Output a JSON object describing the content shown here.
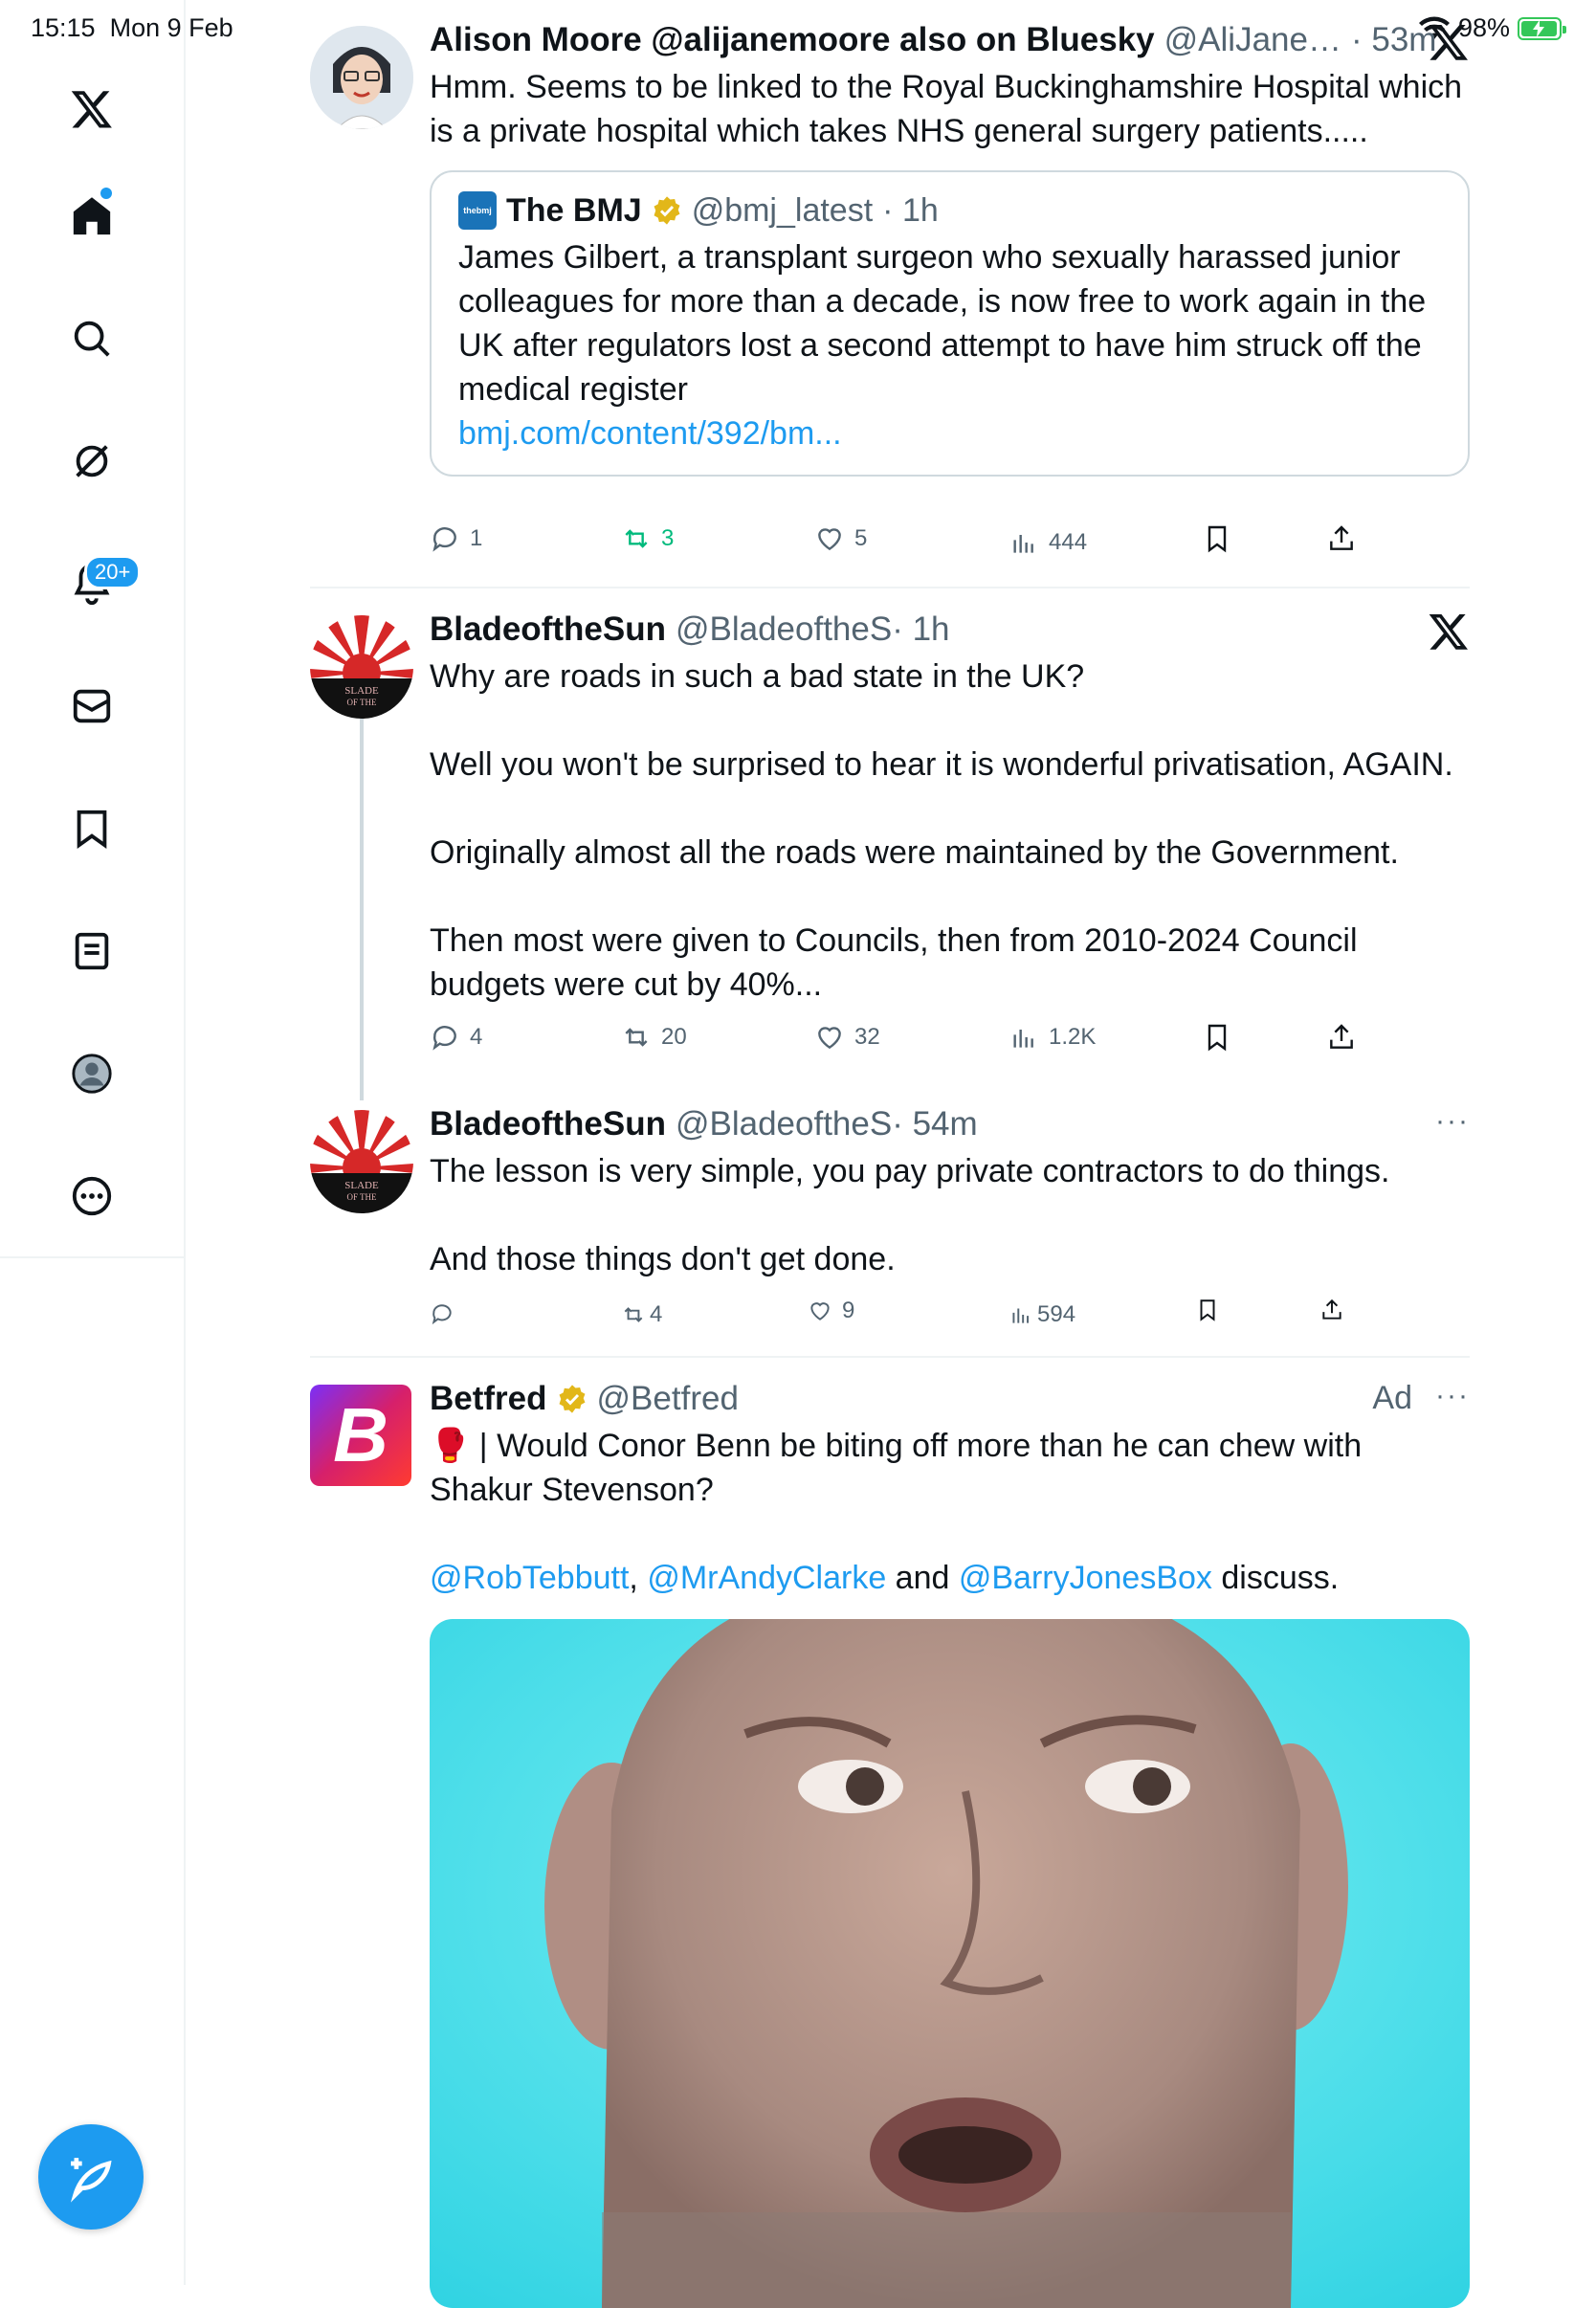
{
  "status_bar": {
    "time": "15:15",
    "date": "Mon 9 Feb",
    "battery_percent": "98%",
    "battery_level": 0.98
  },
  "sidebar": {
    "notification_badge": "20+",
    "icons": [
      "x-logo-icon",
      "home-icon",
      "search-icon",
      "grok-icon",
      "notifications-icon",
      "messages-icon",
      "bookmarks-icon",
      "lists-icon",
      "profile-icon",
      "more-icon"
    ],
    "compose_icon": "compose-icon"
  },
  "tweets": [
    {
      "name": "Alison Moore @alijanemoore also on Bluesky",
      "handle": "@AliJane…",
      "time": "· 53m",
      "text": "Hmm. Seems to be linked to the Royal Buckinghamshire Hospital which is a private hospital which takes NHS general surgery patients.....",
      "quote": {
        "logo_text": "thebmj",
        "name": "The BMJ",
        "handle": "@bmj_latest",
        "time": "· 1h",
        "text": "James Gilbert, a transplant surgeon who sexually harassed junior colleagues for more than a decade, is now free to work again in the UK after regulators lost a second attempt to have him struck off the medical register",
        "link": "bmj.com/content/392/bm..."
      },
      "replies": "1",
      "retweets": "3",
      "likes": "5",
      "views": "444"
    },
    {
      "name": "BladeoftheSun",
      "handle": "@BladeoftheS",
      "time": "· 1h",
      "avatar_text_1": "SLADE",
      "avatar_text_2": "OF THE",
      "paragraphs": [
        "Why are roads in such a bad state in the UK?",
        "Well you won't be surprised to hear it is wonderful privatisation, AGAIN.",
        "Originally almost all the roads were maintained by the Government.",
        "Then most were given to Councils, then from 2010-2024 Council budgets were cut by 40%..."
      ],
      "replies": "4",
      "retweets": "20",
      "likes": "32",
      "views": "1.2K"
    },
    {
      "name": "BladeoftheSun",
      "handle": "@BladeoftheS",
      "time": "· 54m",
      "avatar_text_1": "SLADE",
      "avatar_text_2": "OF THE",
      "paragraphs": [
        "The lesson is very simple, you pay private contractors to do things.",
        "And those things don't get done."
      ],
      "retweets": "4",
      "likes": "9",
      "views": "594"
    },
    {
      "name": "Betfred",
      "handle": "@Betfred",
      "ad_label": "Ad",
      "logo_letter": "B",
      "line1_emoji": "🥊",
      "line1": " | Would Conor Benn be biting off more than he can chew with Shakur Stevenson?",
      "mention1": "@RobTebbutt",
      "sep1": ", ",
      "mention2": "@MrAndyClarke",
      "sep2": " and ",
      "mention3": "@BarryJonesBox",
      "tail": " discuss."
    }
  ]
}
